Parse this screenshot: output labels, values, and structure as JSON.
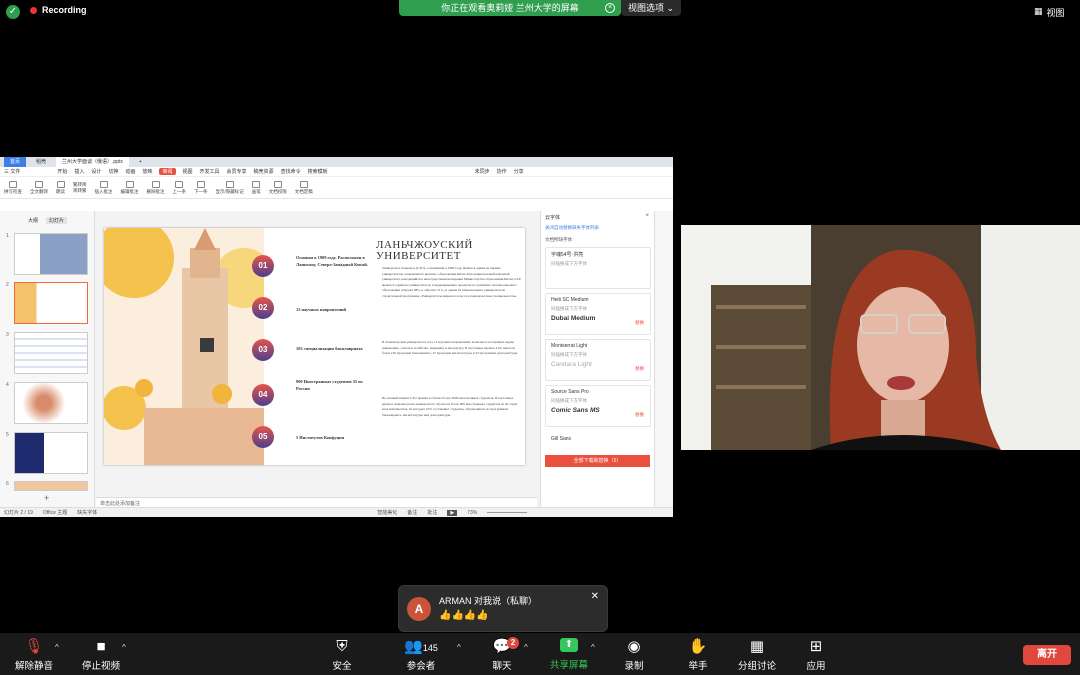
{
  "top": {
    "recording": "Recording",
    "banner": "你正在观看奥莉娅 兰州大学的屏幕",
    "view_options": "视图选项",
    "view": "视图"
  },
  "ppt": {
    "tabs": [
      "首页",
      "稻壳",
      "兰州大学面谈（俄语）.pptx"
    ],
    "menu": [
      "三 文件",
      "开始",
      "插入",
      "设计",
      "切换",
      "动画",
      "放映",
      "审阅",
      "视图",
      "开发工具",
      "会员专享",
      "稿壳资源",
      "查找命令",
      "搜索模板"
    ],
    "menu_selected": "审阅",
    "right_menu": [
      "未同步",
      "协作",
      "分享"
    ],
    "ribbon": [
      "拼写检查",
      "全文翻译",
      "朗读",
      "繁转简",
      "简转繁",
      "插入批注",
      "编辑批注",
      "删除批注",
      "上一条",
      "下一条",
      "显示/隐藏标记",
      "画笔",
      "文档权限",
      "文档定稿"
    ],
    "thumb_tabs": [
      "大纲",
      "幻灯片"
    ],
    "thumb_numbers": [
      "1",
      "2",
      "3",
      "4",
      "5",
      "6"
    ],
    "slide": {
      "title_line1": "ЛАНЬЧЖОУСКИЙ",
      "title_line2": "УНИВЕРСИТЕТ",
      "items": [
        {
          "num": "01",
          "text": "Основан в 1909 году. Расположен в Ланьчжоу, Северо-Западный Китай."
        },
        {
          "num": "02",
          "text": "12 научных направлений"
        },
        {
          "num": "03",
          "text": "103 специализации бакалавриата"
        },
        {
          "num": "04",
          "text": "900 Иностранных студентов 55 из России"
        },
        {
          "num": "05",
          "text": "5 Институтов Конфуция"
        }
      ],
      "paragraph1": "Университет Ланьчжоу (LZU), основанный в 1909 году, является одним из первых университетов современного высшего образования Китая. Как национальный ключевой университет, находящийся в непосредственном ведении Министерства образования Китая, LZU является одним из университетов, поддерживаемых проектом по развитию системы высшего образования «Проект 985» и «Проект 211», и одним из национальных университетов строительной программы «Университеты мирового класса и первоклассные специальности».",
      "paragraph2": "В Ланьчжоуском университете есть 12 научных направлений, включая естественные науки, инженерию, сельское хозяйство, медицину и литературу. В настоящее время в LZU имеется более 100 программ бакалавриата, 47 программ магистратуры и 33 программы докторантуры.",
      "paragraph3": "На данный момент LZU принял и обучил более 3000 иностранных студентов. В настоящее время в Ланьчжоуском университете обучается более 900 иностранных студентов из 40 стран всех континентов, из которых 10% составляют студенты, обучающиеся по программам бакалавриата, магистратуры или докторантуры."
    },
    "notes": "单击此处添加备注",
    "status": [
      "幻灯片 2 / 19",
      "Office 主题",
      "缺失字体",
      "智能美化",
      "备注",
      "批注",
      "73%"
    ],
    "font_panel": {
      "title": "云字体",
      "link": "关闭自动替换缺失字体列表",
      "section": "文档所缺字体",
      "fonts": [
        {
          "name": "字魂54号·洪亮",
          "sub": "同插换成下方字体",
          "preview": "",
          "action": ""
        },
        {
          "name": "Heiti SC Medium",
          "sub": "同插换成下方字体",
          "preview": "Dubai Medium",
          "action": "替换"
        },
        {
          "name": "Montserrat Light",
          "sub": "同插换成下方字体",
          "preview": "Candara Light",
          "action": "替换"
        },
        {
          "name": "Source Sans Pro",
          "sub": "同插换成下方字体",
          "preview": "Comic Sans MS",
          "action": "替换"
        },
        {
          "name": "Gill Sans",
          "sub": "",
          "preview": "",
          "action": ""
        }
      ],
      "download_all": "全部下载和替换（5）"
    }
  },
  "chat": {
    "avatar": "A",
    "sender": "ARMAN 对我说（私聊）",
    "message": "👍👍👍👍"
  },
  "toolbar": {
    "mute": "解除静音",
    "video": "停止视频",
    "security": "安全",
    "participants": "参会者",
    "participant_count": "145",
    "chat": "聊天",
    "chat_badge": "2",
    "share": "共享屏幕",
    "record": "录制",
    "raise": "举手",
    "breakout": "分组讨论",
    "apps": "应用",
    "leave": "离开"
  }
}
